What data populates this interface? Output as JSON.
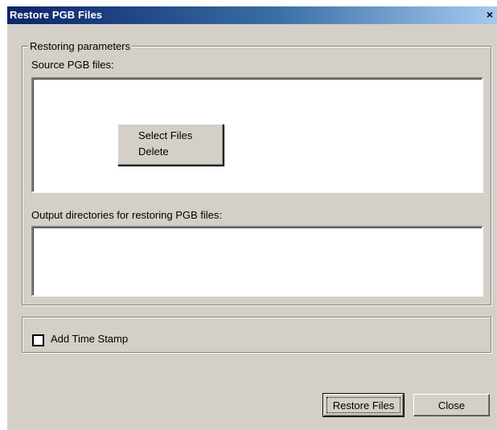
{
  "window": {
    "title": "Restore PGB Files",
    "close_glyph": "×"
  },
  "restoring_group": {
    "legend": "Restoring parameters",
    "source_label": "Source PGB files:",
    "output_label": "Output directories for restoring PGB files:"
  },
  "context_menu": {
    "items": [
      {
        "label": "Select Files"
      },
      {
        "label": "Delete"
      }
    ]
  },
  "timestamp": {
    "label": "Add Time Stamp",
    "checked": false
  },
  "buttons": {
    "restore_label": "Restore Files",
    "close_label": "Close"
  }
}
